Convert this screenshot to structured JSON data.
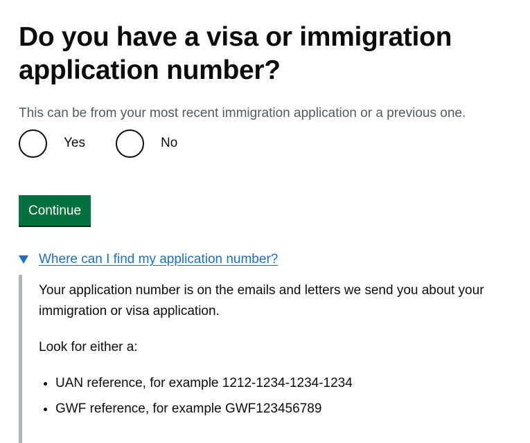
{
  "question": {
    "title": "Do you have a visa or immigration application number?",
    "hint": "This can be from your most recent immigration application or a previous one."
  },
  "radios": [
    {
      "label": "Yes",
      "selected": false
    },
    {
      "label": "No",
      "selected": false
    }
  ],
  "continue_label": "Continue",
  "details": {
    "summary": "Where can I find my application number?",
    "expanded": true,
    "paragraph1": "Your application number is on the emails and letters we send you about your immigration or visa application.",
    "paragraph2": "Look for either a:",
    "list": [
      "UAN reference, for example 1212-1234-1234-1234",
      "GWF reference, for example GWF123456789"
    ]
  },
  "colors": {
    "button_green": "#00703c",
    "link_blue": "#1d70b8",
    "hint_grey": "#505a5f",
    "border_grey": "#b1b4b6"
  }
}
